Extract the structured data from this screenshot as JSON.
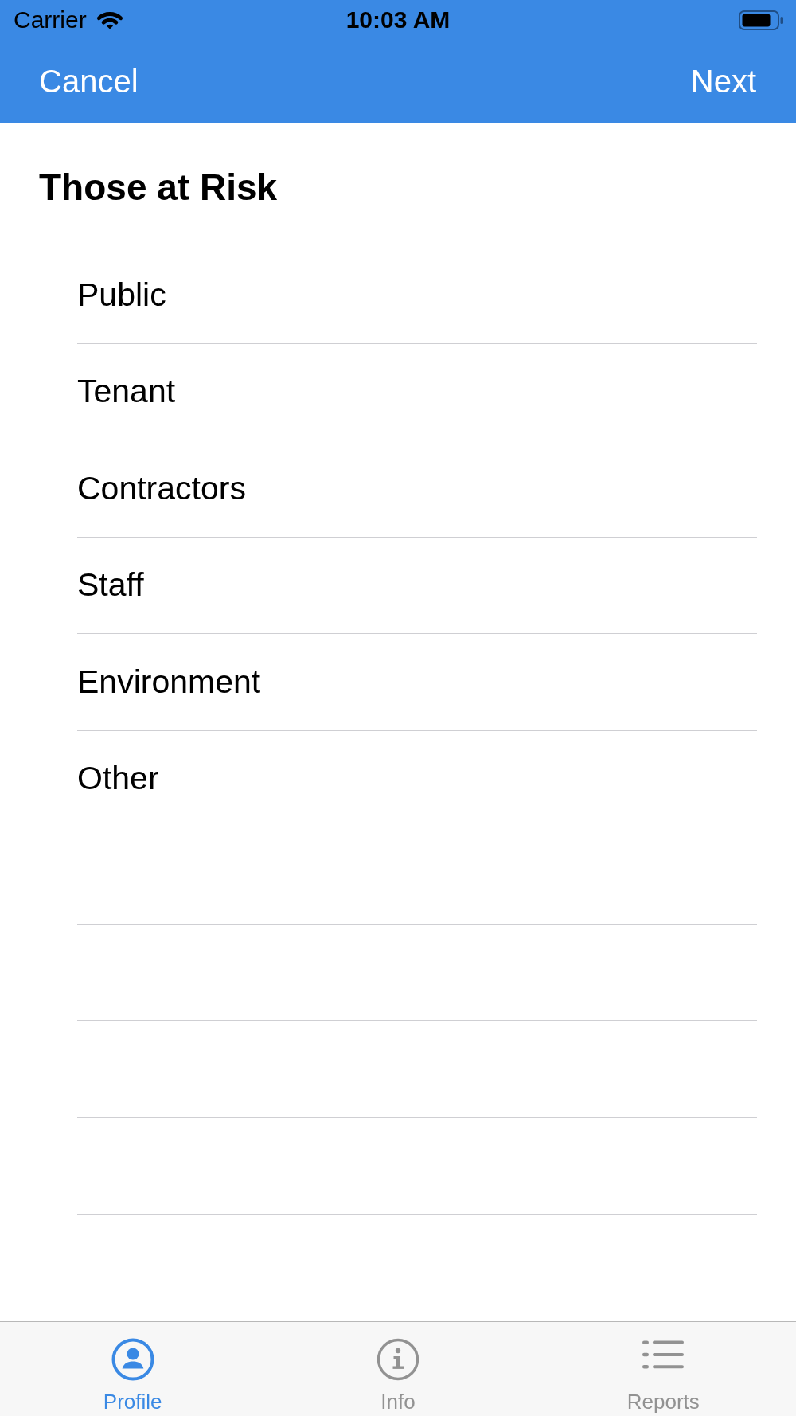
{
  "status_bar": {
    "carrier": "Carrier",
    "time": "10:03 AM"
  },
  "nav_bar": {
    "left_button": "Cancel",
    "right_button": "Next"
  },
  "title": "Those at Risk",
  "list": {
    "items": [
      {
        "label": "Public"
      },
      {
        "label": "Tenant"
      },
      {
        "label": "Contractors"
      },
      {
        "label": "Staff"
      },
      {
        "label": "Environment"
      },
      {
        "label": "Other"
      }
    ]
  },
  "tab_bar": {
    "tabs": [
      {
        "label": "Profile",
        "kind": "profile",
        "selected": true
      },
      {
        "label": "Info",
        "kind": "info",
        "selected": false
      },
      {
        "label": "Reports",
        "kind": "reports",
        "selected": false
      }
    ]
  }
}
